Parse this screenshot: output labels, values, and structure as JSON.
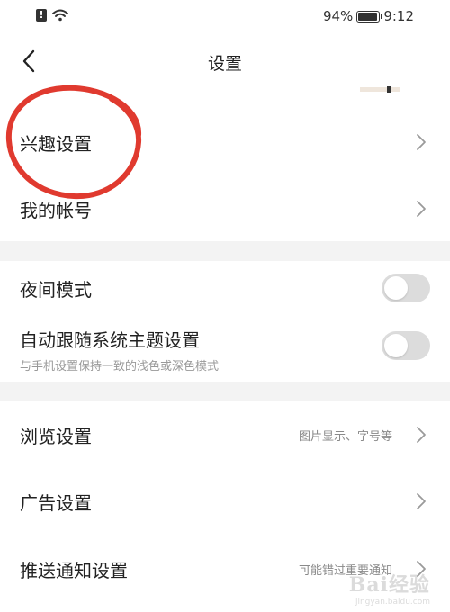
{
  "status_bar": {
    "battery_percent": "94%",
    "battery_level": 0.94,
    "time": "9:12"
  },
  "nav": {
    "title": "设置",
    "back_icon": "chevron-left-icon"
  },
  "section1": {
    "items": [
      {
        "label": "兴趣设置"
      },
      {
        "label": "我的帐号"
      }
    ]
  },
  "section2": {
    "night_mode": {
      "label": "夜间模式",
      "enabled": false
    },
    "follow_system": {
      "label": "自动跟随系统主题设置",
      "sublabel": "与手机设置保持一致的浅色或深色模式",
      "enabled": false
    }
  },
  "section3": {
    "items": [
      {
        "label": "浏览设置",
        "hint": "图片显示、字号等"
      },
      {
        "label": "广告设置",
        "hint": ""
      },
      {
        "label": "推送通知设置",
        "hint": "可能错过重要通知"
      }
    ]
  },
  "annotation": {
    "color": "#e03a2f"
  },
  "watermark": {
    "logo": "Bai经验",
    "url": "jingyan.baidu.com"
  },
  "colors": {
    "toggle_off": "#dcdcdc",
    "divider": "#f3f3f3",
    "chevron": "#9a9a9a"
  }
}
